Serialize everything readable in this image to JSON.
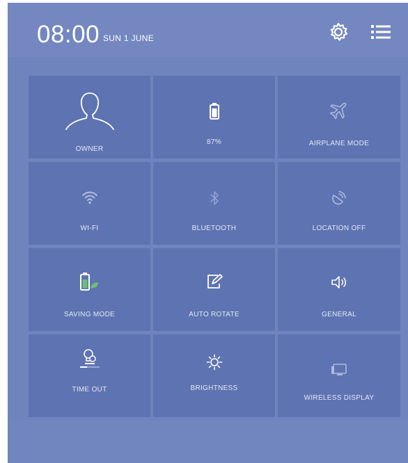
{
  "status": {
    "time": "08:00",
    "date": "SUN 1 JUNE"
  },
  "header_icons": [
    "gear-icon",
    "menu-list-icon"
  ],
  "tiles": [
    {
      "label": "OWNER",
      "icon": "user-icon"
    },
    {
      "label": "87%",
      "icon": "battery-icon"
    },
    {
      "label": "AIRPLANE MODE",
      "icon": "airplane-icon"
    },
    {
      "label": "WI-FI",
      "icon": "wifi-icon"
    },
    {
      "label": "BLUETOOTH",
      "icon": "bluetooth-icon"
    },
    {
      "label": "LOCATION OFF",
      "icon": "location-icon"
    },
    {
      "label": "SAVING MODE",
      "icon": "battery-leaf-icon"
    },
    {
      "label": "AUTO ROTATE",
      "icon": "rotate-icon"
    },
    {
      "label": "GENERAL",
      "icon": "speaker-icon"
    },
    {
      "label": "TIME OUT",
      "icon": "bulb-timer-icon"
    },
    {
      "label": "BRIGHTNESS",
      "icon": "sun-icon"
    },
    {
      "label": "WIRELESS DISPLAY",
      "icon": "cast-display-icon"
    }
  ],
  "colors": {
    "panel": "#6f84bd",
    "tile": "#5e73b1",
    "text": "#ffffff"
  }
}
